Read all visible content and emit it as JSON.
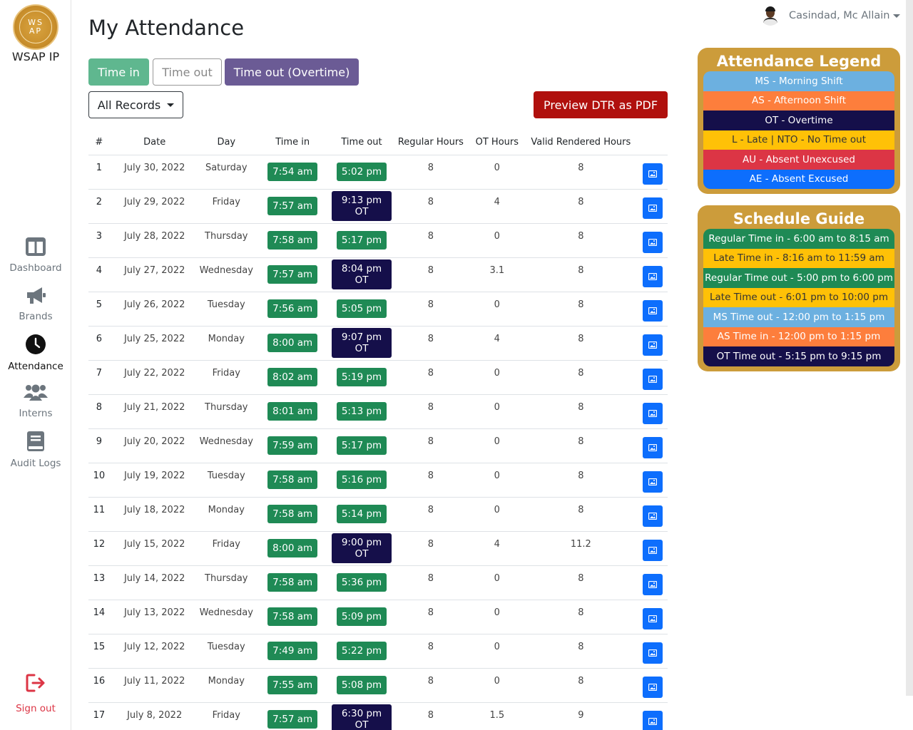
{
  "app": {
    "brand": "WSAP IP",
    "logo_text": [
      "WS",
      "AP"
    ]
  },
  "header": {
    "title": "My Attendance",
    "user_name": "Casindad, Mc Allain"
  },
  "sidebar": {
    "items": [
      {
        "label": "Dashboard",
        "icon": "dashboard-icon"
      },
      {
        "label": "Brands",
        "icon": "megaphone-icon"
      },
      {
        "label": "Attendance",
        "icon": "clock-icon"
      },
      {
        "label": "Interns",
        "icon": "users-icon"
      },
      {
        "label": "Audit Logs",
        "icon": "book-icon"
      }
    ],
    "signout_label": "Sign out"
  },
  "toolbar": {
    "time_in": "Time in",
    "time_out": "Time out",
    "time_out_ot": "Time out (Overtime)",
    "filter": "All Records",
    "preview_pdf": "Preview DTR as PDF"
  },
  "table": {
    "headers": [
      "#",
      "Date",
      "Day",
      "Time in",
      "Time out",
      "Regular Hours",
      "OT Hours",
      "Valid Rendered Hours"
    ],
    "rows": [
      {
        "n": "1",
        "date": "July 30, 2022",
        "day": "Saturday",
        "in": "7:54 am",
        "out": "5:02 pm",
        "ot": false,
        "reg": "8",
        "oth": "0",
        "valid": "8"
      },
      {
        "n": "2",
        "date": "July 29, 2022",
        "day": "Friday",
        "in": "7:57 am",
        "out": "9:13 pm OT",
        "ot": true,
        "reg": "8",
        "oth": "4",
        "valid": "8"
      },
      {
        "n": "3",
        "date": "July 28, 2022",
        "day": "Thursday",
        "in": "7:58 am",
        "out": "5:17 pm",
        "ot": false,
        "reg": "8",
        "oth": "0",
        "valid": "8"
      },
      {
        "n": "4",
        "date": "July 27, 2022",
        "day": "Wednesday",
        "in": "7:57 am",
        "out": "8:04 pm OT",
        "ot": true,
        "reg": "8",
        "oth": "3.1",
        "valid": "8"
      },
      {
        "n": "5",
        "date": "July 26, 2022",
        "day": "Tuesday",
        "in": "7:56 am",
        "out": "5:05 pm",
        "ot": false,
        "reg": "8",
        "oth": "0",
        "valid": "8"
      },
      {
        "n": "6",
        "date": "July 25, 2022",
        "day": "Monday",
        "in": "8:00 am",
        "out": "9:07 pm OT",
        "ot": true,
        "reg": "8",
        "oth": "4",
        "valid": "8"
      },
      {
        "n": "7",
        "date": "July 22, 2022",
        "day": "Friday",
        "in": "8:02 am",
        "out": "5:19 pm",
        "ot": false,
        "reg": "8",
        "oth": "0",
        "valid": "8"
      },
      {
        "n": "8",
        "date": "July 21, 2022",
        "day": "Thursday",
        "in": "8:01 am",
        "out": "5:13 pm",
        "ot": false,
        "reg": "8",
        "oth": "0",
        "valid": "8"
      },
      {
        "n": "9",
        "date": "July 20, 2022",
        "day": "Wednesday",
        "in": "7:59 am",
        "out": "5:17 pm",
        "ot": false,
        "reg": "8",
        "oth": "0",
        "valid": "8"
      },
      {
        "n": "10",
        "date": "July 19, 2022",
        "day": "Tuesday",
        "in": "7:58 am",
        "out": "5:16 pm",
        "ot": false,
        "reg": "8",
        "oth": "0",
        "valid": "8"
      },
      {
        "n": "11",
        "date": "July 18, 2022",
        "day": "Monday",
        "in": "7:58 am",
        "out": "5:14 pm",
        "ot": false,
        "reg": "8",
        "oth": "0",
        "valid": "8"
      },
      {
        "n": "12",
        "date": "July 15, 2022",
        "day": "Friday",
        "in": "8:00 am",
        "out": "9:00 pm OT",
        "ot": true,
        "reg": "8",
        "oth": "4",
        "valid": "11.2"
      },
      {
        "n": "13",
        "date": "July 14, 2022",
        "day": "Thursday",
        "in": "7:58 am",
        "out": "5:36 pm",
        "ot": false,
        "reg": "8",
        "oth": "0",
        "valid": "8"
      },
      {
        "n": "14",
        "date": "July 13, 2022",
        "day": "Wednesday",
        "in": "7:58 am",
        "out": "5:09 pm",
        "ot": false,
        "reg": "8",
        "oth": "0",
        "valid": "8"
      },
      {
        "n": "15",
        "date": "July 12, 2022",
        "day": "Tuesday",
        "in": "7:49 am",
        "out": "5:22 pm",
        "ot": false,
        "reg": "8",
        "oth": "0",
        "valid": "8"
      },
      {
        "n": "16",
        "date": "July 11, 2022",
        "day": "Monday",
        "in": "7:55 am",
        "out": "5:08 pm",
        "ot": false,
        "reg": "8",
        "oth": "0",
        "valid": "8"
      },
      {
        "n": "17",
        "date": "July 8, 2022",
        "day": "Friday",
        "in": "7:57 am",
        "out": "6:30 pm OT",
        "ot": true,
        "reg": "8",
        "oth": "1.5",
        "valid": "9"
      }
    ]
  },
  "attendance_legend": {
    "title": "Attendance Legend",
    "items": [
      {
        "label": "MS - Morning Shift",
        "bg": "#6cb0e0",
        "fg": "#ffffff"
      },
      {
        "label": "AS - Afternoon Shift",
        "bg": "#fd7e3c",
        "fg": "#ffffff"
      },
      {
        "label": "OT - Overtime",
        "bg": "#150f4a",
        "fg": "#ffffff"
      },
      {
        "label": "L - Late | NTO - No Time out",
        "bg": "#ffc107",
        "fg": "#333333"
      },
      {
        "label": "AU - Absent Unexcused",
        "bg": "#dc3545",
        "fg": "#ffffff"
      },
      {
        "label": "AE - Absent Excused",
        "bg": "#0d6efd",
        "fg": "#ffffff"
      }
    ]
  },
  "schedule_guide": {
    "title": "Schedule Guide",
    "items": [
      {
        "label": "Regular Time in - 6:00 am to 8:15 am",
        "bg": "#1f8a55",
        "fg": "#ffffff"
      },
      {
        "label": "Late Time in - 8:16 am to 11:59 am",
        "bg": "#ffc107",
        "fg": "#333333"
      },
      {
        "label": "Regular Time out - 5:00 pm to 6:00 pm",
        "bg": "#1f8a55",
        "fg": "#ffffff"
      },
      {
        "label": "Late Time out - 6:01 pm to 10:00 pm",
        "bg": "#ffc107",
        "fg": "#333333"
      },
      {
        "label": "MS Time out - 12:00 pm to 1:15 pm",
        "bg": "#6cb0e0",
        "fg": "#ffffff"
      },
      {
        "label": "AS Time in - 12:00 pm to 1:15 pm",
        "bg": "#fd7e3c",
        "fg": "#ffffff"
      },
      {
        "label": "OT Time out - 5:15 pm to 9:15 pm",
        "bg": "#150f4a",
        "fg": "#ffffff"
      }
    ]
  },
  "colors": {
    "accent_green": "#1f8a55",
    "ot_navy": "#150f4a",
    "pdf_red": "#b0100d",
    "panel_gold": "#cc9c3b",
    "image_blue": "#0d6efd"
  }
}
